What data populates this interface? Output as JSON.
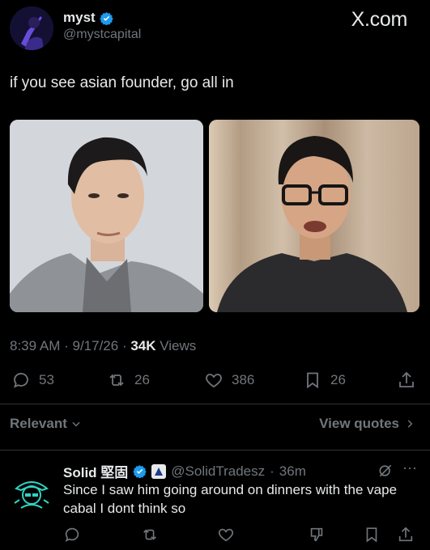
{
  "header": {
    "display_name": "myst",
    "handle": "@mystcapital",
    "site": "X.com"
  },
  "tweet": {
    "text": "if you see asian founder, go all in",
    "time": "8:39 AM",
    "date": "9/17/26",
    "views_count": "34K",
    "views_label": "Views"
  },
  "actions": {
    "replies": "53",
    "reposts": "26",
    "likes": "386",
    "bookmarks": "26"
  },
  "filter": {
    "relevant_label": "Relevant",
    "view_quotes_label": "View quotes"
  },
  "reply": {
    "display_name": "Solid 堅固",
    "handle": "@SolidTradesz",
    "time": "36m",
    "text": "Since I saw him going around on dinners with the vape cabal I dont think so"
  },
  "colors": {
    "background": "#000000",
    "text_primary": "#e7e9ea",
    "text_secondary": "#71767b",
    "verified_blue": "#1d9bf0",
    "divider": "#2f3336"
  }
}
